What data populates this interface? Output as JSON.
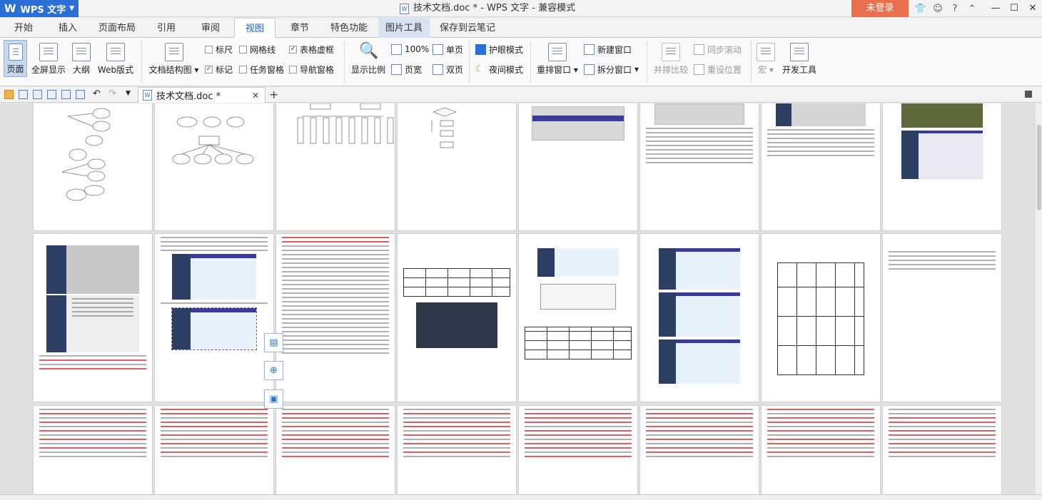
{
  "app": {
    "name": "WPS 文字",
    "title": "技术文档.doc * - WPS 文字 - 兼容模式",
    "login": "未登录"
  },
  "tabs": [
    "开始",
    "插入",
    "页面布局",
    "引用",
    "审阅",
    "视图",
    "章节",
    "特色功能",
    "图片工具",
    "保存到云笔记"
  ],
  "active_tab": "视图",
  "ribbon": {
    "views": [
      "页面",
      "全屏显示",
      "大纲",
      "Web版式"
    ],
    "doc_map": "文档结构图",
    "checks": [
      {
        "label": "标尺",
        "checked": false
      },
      {
        "label": "网格线",
        "checked": false
      },
      {
        "label": "表格虚框",
        "checked": true
      },
      {
        "label": "标记",
        "checked": true
      },
      {
        "label": "任务窗格",
        "checked": false
      },
      {
        "label": "导航窗格",
        "checked": false
      }
    ],
    "zoom": "显示比例",
    "zoom_100": "100%",
    "single": "单页",
    "fit_width": "页宽",
    "double": "双页",
    "eye": "护眼模式",
    "night": "夜间模式",
    "arrange": "重排窗口",
    "new_window": "新建窗口",
    "split": "拆分窗口",
    "side_by_side": "并排比较",
    "sync_scroll": "同步滚动",
    "reset_pos": "重设位置",
    "macro": "宏",
    "dev": "开发工具"
  },
  "doc_tab": {
    "label": "技术文档.doc *"
  },
  "colors": {
    "accent": "#2a6fd6",
    "login": "#e8704e"
  }
}
